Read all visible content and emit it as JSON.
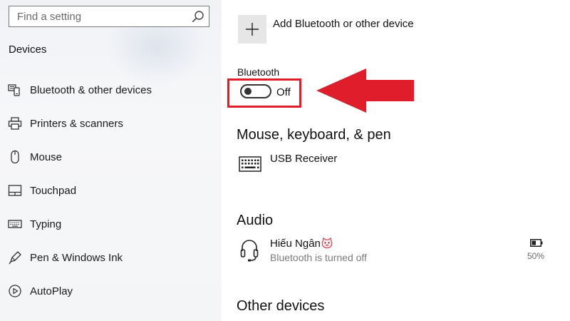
{
  "search": {
    "placeholder": "Find a setting",
    "icon": "search-icon"
  },
  "sidebar": {
    "section_title": "Devices",
    "items": [
      {
        "label": "Bluetooth & other devices",
        "icon": "bluetooth-devices-icon"
      },
      {
        "label": "Printers & scanners",
        "icon": "printer-icon"
      },
      {
        "label": "Mouse",
        "icon": "mouse-icon"
      },
      {
        "label": "Touchpad",
        "icon": "touchpad-icon"
      },
      {
        "label": "Typing",
        "icon": "keyboard-icon"
      },
      {
        "label": "Pen & Windows Ink",
        "icon": "pen-icon"
      },
      {
        "label": "AutoPlay",
        "icon": "autoplay-icon"
      }
    ]
  },
  "main": {
    "add_device": {
      "label": "Add Bluetooth or other device",
      "icon": "plus-icon"
    },
    "bluetooth": {
      "label": "Bluetooth",
      "state": "Off",
      "enabled": false
    },
    "mouse_keyboard_pen": {
      "heading": "Mouse, keyboard, & pen",
      "devices": [
        {
          "name": "USB Receiver",
          "icon": "keyboard-icon"
        }
      ]
    },
    "audio": {
      "heading": "Audio",
      "devices": [
        {
          "name": "Hiếu Ngân",
          "status": "Bluetooth is turned off",
          "icon": "headset-icon",
          "battery": "50%",
          "emoji": "cat-face-icon"
        }
      ]
    },
    "other_devices": {
      "heading": "Other devices"
    }
  },
  "annotation": {
    "arrow_color": "#e01e2b",
    "highlight_color": "#e01e2b"
  },
  "colors": {
    "sidebar_bg": "#f2f3f6",
    "accent_red": "#e01e2b",
    "text_secondary": "#7a7a7a"
  }
}
